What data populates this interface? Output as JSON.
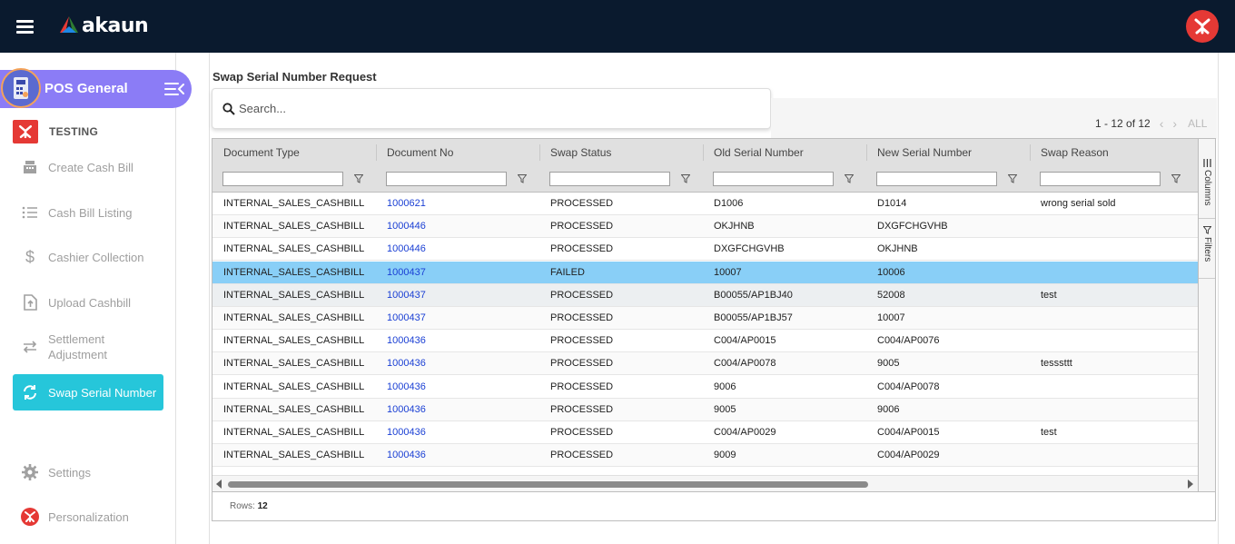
{
  "app": {
    "logo_text": "akaun"
  },
  "sidebar": {
    "module_title": "POS General",
    "company_label": "TESTING",
    "items": [
      {
        "label": "Create Cash Bill",
        "icon": "cash-register-icon"
      },
      {
        "label": "Cash Bill Listing",
        "icon": "list-icon"
      },
      {
        "label": "Cashier Collection",
        "icon": "dollar-icon"
      },
      {
        "label": "Upload Cashbill",
        "icon": "upload-icon"
      },
      {
        "label": "Settlement Adjustment",
        "icon": "swap-arrows-icon"
      },
      {
        "label": "Swap Serial Number",
        "icon": "refresh-icon",
        "active": true
      },
      {
        "label": "Settings",
        "icon": "gear-icon"
      },
      {
        "label": "Personalization",
        "icon": "brand-icon"
      }
    ]
  },
  "page": {
    "title": "Swap Serial Number Request",
    "search_placeholder": "Search...",
    "pager_text": "1 - 12 of 12",
    "pager_all": "ALL"
  },
  "grid": {
    "columns": [
      "Document Type",
      "Document No",
      "Swap Status",
      "Old Serial Number",
      "New Serial Number",
      "Swap Reason"
    ],
    "rows": [
      [
        "INTERNAL_SALES_CASHBILL",
        "1000621",
        "PROCESSED",
        "D1006",
        "D1014",
        "wrong serial sold"
      ],
      [
        "INTERNAL_SALES_CASHBILL",
        "1000446",
        "PROCESSED",
        "OKJHNB",
        "DXGFCHGVHB",
        ""
      ],
      [
        "INTERNAL_SALES_CASHBILL",
        "1000446",
        "PROCESSED",
        "DXGFCHGVHB",
        "OKJHNB",
        ""
      ],
      [
        "INTERNAL_SALES_CASHBILL",
        "1000437",
        "FAILED",
        "10007",
        "10006",
        ""
      ],
      [
        "INTERNAL_SALES_CASHBILL",
        "1000437",
        "PROCESSED",
        "B00055/AP1BJ40",
        "52008",
        "test"
      ],
      [
        "INTERNAL_SALES_CASHBILL",
        "1000437",
        "PROCESSED",
        "B00055/AP1BJ57",
        "10007",
        ""
      ],
      [
        "INTERNAL_SALES_CASHBILL",
        "1000436",
        "PROCESSED",
        "C004/AP0015",
        "C004/AP0076",
        ""
      ],
      [
        "INTERNAL_SALES_CASHBILL",
        "1000436",
        "PROCESSED",
        "C004/AP0078",
        "9005",
        "tesssttt"
      ],
      [
        "INTERNAL_SALES_CASHBILL",
        "1000436",
        "PROCESSED",
        "9006",
        "C004/AP0078",
        ""
      ],
      [
        "INTERNAL_SALES_CASHBILL",
        "1000436",
        "PROCESSED",
        "9005",
        "9006",
        ""
      ],
      [
        "INTERNAL_SALES_CASHBILL",
        "1000436",
        "PROCESSED",
        "C004/AP0029",
        "C004/AP0015",
        "test"
      ],
      [
        "INTERNAL_SALES_CASHBILL",
        "1000436",
        "PROCESSED",
        "9009",
        "C004/AP0029",
        ""
      ]
    ],
    "selected_row": 3,
    "hover_row": 4,
    "side_tabs": {
      "columns": "Columns",
      "filters": "Filters"
    },
    "status_label": "Rows:",
    "status_value": "12"
  },
  "colors": {
    "topbar": "#0a1a2e",
    "accent_active": "#26c6da",
    "module_pill": "#8b7cf6",
    "selected_row": "#89cff7",
    "link": "#1a3fd4"
  }
}
